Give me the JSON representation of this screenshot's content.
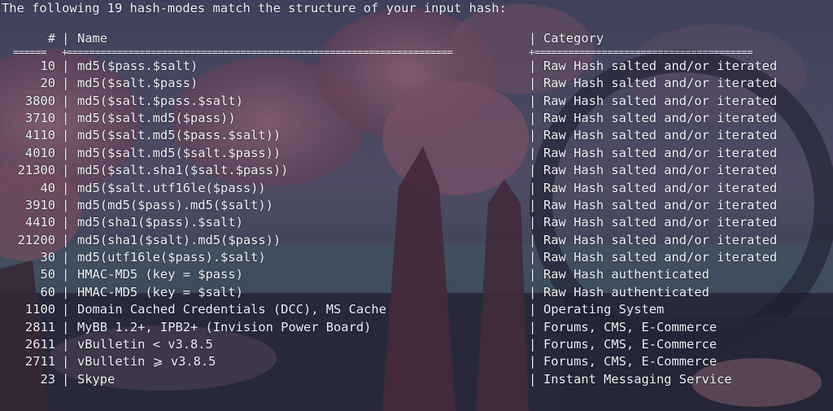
{
  "intro": "The following 19 hash-modes match the structure of your input hash:",
  "table": {
    "headers": {
      "num": "#",
      "sep": "|",
      "name": "Name",
      "category": "Category"
    },
    "rule": {
      "num": "======",
      "join": "+",
      "name": "=====================================================================",
      "category": "======================================="
    },
    "rows": [
      {
        "num": "10",
        "name": "md5($pass.$salt)",
        "category": "Raw Hash salted and/or iterated"
      },
      {
        "num": "20",
        "name": "md5($salt.$pass)",
        "category": "Raw Hash salted and/or iterated"
      },
      {
        "num": "3800",
        "name": "md5($salt.$pass.$salt)",
        "category": "Raw Hash salted and/or iterated"
      },
      {
        "num": "3710",
        "name": "md5($salt.md5($pass))",
        "category": "Raw Hash salted and/or iterated"
      },
      {
        "num": "4110",
        "name": "md5($salt.md5($pass.$salt))",
        "category": "Raw Hash salted and/or iterated"
      },
      {
        "num": "4010",
        "name": "md5($salt.md5($salt.$pass))",
        "category": "Raw Hash salted and/or iterated"
      },
      {
        "num": "21300",
        "name": "md5($salt.sha1($salt.$pass))",
        "category": "Raw Hash salted and/or iterated"
      },
      {
        "num": "40",
        "name": "md5($salt.utf16le($pass))",
        "category": "Raw Hash salted and/or iterated"
      },
      {
        "num": "3910",
        "name": "md5(md5($pass).md5($salt))",
        "category": "Raw Hash salted and/or iterated"
      },
      {
        "num": "4410",
        "name": "md5(sha1($pass).$salt)",
        "category": "Raw Hash salted and/or iterated"
      },
      {
        "num": "21200",
        "name": "md5(sha1($salt).md5($pass))",
        "category": "Raw Hash salted and/or iterated"
      },
      {
        "num": "30",
        "name": "md5(utf16le($pass).$salt)",
        "category": "Raw Hash salted and/or iterated"
      },
      {
        "num": "50",
        "name": "HMAC-MD5 (key = $pass)",
        "category": "Raw Hash authenticated"
      },
      {
        "num": "60",
        "name": "HMAC-MD5 (key = $salt)",
        "category": "Raw Hash authenticated"
      },
      {
        "num": "1100",
        "name": "Domain Cached Credentials (DCC), MS Cache",
        "category": "Operating System"
      },
      {
        "num": "2811",
        "name": "MyBB 1.2+, IPB2+ (Invision Power Board)",
        "category": "Forums, CMS, E-Commerce"
      },
      {
        "num": "2611",
        "name": "vBulletin < v3.8.5",
        "category": "Forums, CMS, E-Commerce"
      },
      {
        "num": "2711",
        "name": "vBulletin ⩾ v3.8.5",
        "category": "Forums, CMS, E-Commerce"
      },
      {
        "num": "23",
        "name": "Skype",
        "category": "Instant Messaging Service"
      }
    ]
  },
  "colors": {
    "text": "#eef0f6",
    "wallpaper_sky": "#4a4e68",
    "wallpaper_blossom": "#b5728c",
    "wallpaper_trunk": "#5a3442"
  }
}
